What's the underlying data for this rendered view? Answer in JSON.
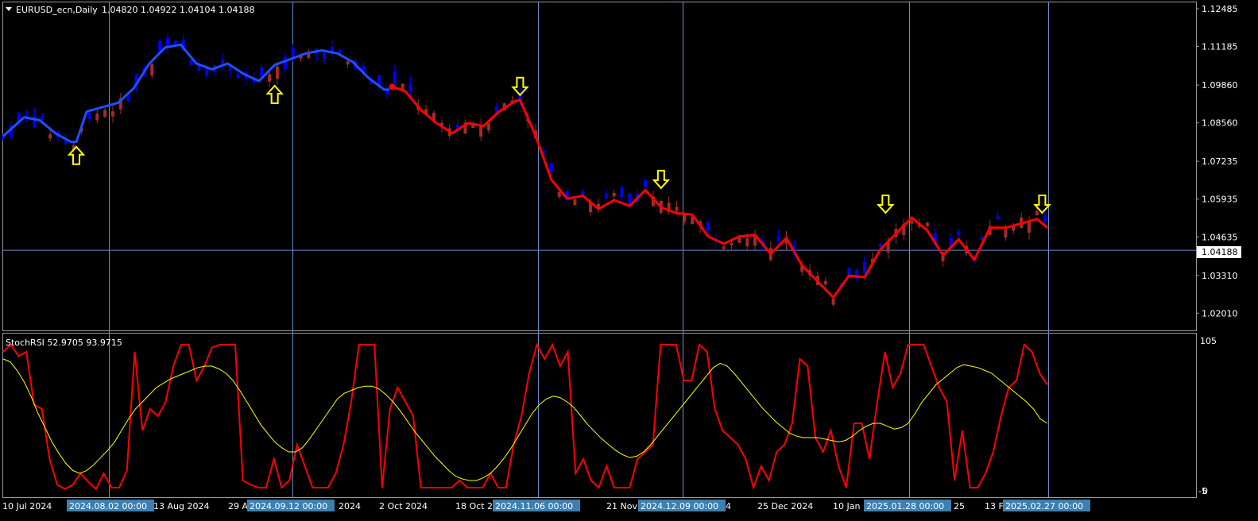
{
  "header": {
    "symbol": "EURUSD_ecn,Daily",
    "ohlc": "1.04820 1.04922 1.04104 1.04188"
  },
  "price_axis": {
    "ticks": [
      "1.12485",
      "1.11185",
      "1.09860",
      "1.08560",
      "1.07235",
      "1.05935",
      "1.04635",
      "1.03310",
      "1.02010"
    ],
    "tick_values": [
      1.12485,
      1.11185,
      1.0986,
      1.0856,
      1.07235,
      1.05935,
      1.04635,
      1.0331,
      1.0201
    ],
    "current_price_label": "1.04188",
    "current_price": 1.04188
  },
  "time_axis": {
    "labels": [
      "10 Jul 2024",
      "13 Aug 2024",
      "29 A",
      "2024",
      "2 Oct 2024",
      "18 Oct 2",
      "21 Nov",
      "4",
      "25 Dec 2024",
      "10 Jan",
      "25",
      "13 F"
    ],
    "highlighted": [
      "2024.08.02 00:00",
      "2024.09.12 00:00",
      "2024.11.06 00:00",
      "2024.12.09 00:00",
      "2025.01.28 00:00",
      "2025.02.27 00:00"
    ]
  },
  "indicator": {
    "label": "StochRSI 52.9705 93.9715",
    "axis_top": "105",
    "axis_bottom": "-5",
    "axis_bottom2": "0"
  },
  "colors": {
    "background": "#000000",
    "bull_candle": "#0000ff",
    "bear_candle": "#a52a2a",
    "trend_up": "#1e50ff",
    "trend_down": "#ff0000",
    "arrows": "#ffff00",
    "stoch_main": "#ff0000",
    "stoch_signal": "#ffff00",
    "crosshair": "#6a8cc8",
    "date_highlight": "#3c7fb1"
  },
  "chart_data": [
    {
      "type": "candlestick",
      "symbol": "EURUSD_ecn",
      "timeframe": "Daily",
      "ylim": [
        1.015,
        1.1265
      ],
      "last_close": 1.04188,
      "trend_line_up": [
        [
          0,
          1.081
        ],
        [
          8,
          1.0875
        ],
        [
          14,
          1.0865
        ],
        [
          20,
          1.082
        ],
        [
          26,
          1.079
        ],
        [
          28,
          1.079
        ],
        [
          32,
          1.0895
        ],
        [
          38,
          1.091
        ],
        [
          44,
          1.0925
        ],
        [
          50,
          1.0975
        ],
        [
          56,
          1.106
        ],
        [
          62,
          1.1115
        ],
        [
          68,
          1.1125
        ],
        [
          74,
          1.106
        ],
        [
          80,
          1.104
        ],
        [
          86,
          1.106
        ],
        [
          92,
          1.1025
        ],
        [
          98,
          1.1
        ],
        [
          104,
          1.1055
        ],
        [
          110,
          1.1075
        ],
        [
          116,
          1.1095
        ],
        [
          122,
          1.1105
        ],
        [
          128,
          1.1095
        ],
        [
          134,
          1.1065
        ],
        [
          140,
          1.101
        ],
        [
          146,
          1.097
        ],
        [
          148,
          1.097
        ]
      ],
      "trend_line_down": [
        [
          149,
          1.098
        ],
        [
          154,
          1.0965
        ],
        [
          160,
          1.09
        ],
        [
          166,
          1.0855
        ],
        [
          172,
          1.082
        ],
        [
          178,
          1.0855
        ],
        [
          184,
          1.0845
        ],
        [
          190,
          1.0895
        ],
        [
          196,
          1.093
        ],
        [
          198,
          1.0935
        ],
        [
          204,
          1.081
        ],
        [
          210,
          1.066
        ],
        [
          216,
          1.0595
        ],
        [
          222,
          1.0605
        ],
        [
          228,
          1.056
        ],
        [
          234,
          1.059
        ],
        [
          240,
          1.057
        ],
        [
          246,
          1.0625
        ],
        [
          252,
          1.0565
        ],
        [
          258,
          1.0545
        ],
        [
          264,
          1.054
        ],
        [
          270,
          1.0465
        ],
        [
          276,
          1.044
        ],
        [
          282,
          1.0465
        ],
        [
          288,
          1.047
        ],
        [
          294,
          1.0405
        ],
        [
          300,
          1.046
        ],
        [
          306,
          1.0365
        ],
        [
          312,
          1.031
        ],
        [
          318,
          1.0255
        ],
        [
          324,
          1.033
        ],
        [
          330,
          1.0325
        ],
        [
          336,
          1.042
        ],
        [
          342,
          1.0475
        ],
        [
          348,
          1.053
        ],
        [
          354,
          1.0485
        ],
        [
          360,
          1.04
        ],
        [
          366,
          1.0455
        ],
        [
          372,
          1.0385
        ],
        [
          378,
          1.0495
        ],
        [
          384,
          1.0495
        ],
        [
          390,
          1.051
        ],
        [
          396,
          1.0525
        ],
        [
          400,
          1.0495
        ]
      ],
      "arrows_up": [
        {
          "i": 28,
          "price": 1.079
        },
        {
          "i": 104,
          "price": 1.1
        }
      ],
      "arrows_down": [
        {
          "i": 198,
          "price": 1.0935
        },
        {
          "i": 252,
          "price": 1.0615
        },
        {
          "i": 338,
          "price": 1.053
        },
        {
          "i": 398,
          "price": 1.053
        }
      ]
    },
    {
      "type": "line",
      "name": "StochRSI",
      "ylim": [
        -5,
        105
      ],
      "last_values": {
        "main": 52.9705,
        "signal": 93.9715
      },
      "series": [
        {
          "values": [
            95,
            100,
            92,
            95,
            58,
            55,
            20,
            2,
            -1,
            2,
            10,
            4,
            -1,
            10,
            0,
            0,
            12,
            95,
            40,
            55,
            50,
            60,
            85,
            100,
            100,
            75,
            85,
            98,
            100,
            100,
            100,
            5,
            2,
            0,
            0,
            20,
            0,
            5,
            30,
            15,
            0,
            0,
            0,
            10,
            30,
            60,
            100,
            100,
            100,
            0,
            55,
            70,
            60,
            50,
            0,
            0,
            0,
            0,
            0,
            5,
            0,
            0,
            0,
            10,
            0,
            0,
            30,
            50,
            80,
            100,
            90,
            100,
            85,
            95,
            10,
            20,
            5,
            0,
            15,
            0,
            0,
            0,
            20,
            25,
            30,
            100,
            100,
            100,
            75,
            75,
            100,
            95,
            55,
            40,
            35,
            30,
            20,
            0,
            15,
            5,
            25,
            30,
            45,
            90,
            85,
            35,
            25,
            40,
            15,
            0,
            45,
            45,
            20,
            60,
            95,
            70,
            80,
            100,
            100,
            100,
            85,
            70,
            60,
            5,
            40,
            0,
            0,
            10,
            25,
            50,
            70,
            75,
            100,
            95,
            80,
            72
          ]
        },
        {
          "values": [
            90,
            88,
            82,
            74,
            64,
            52,
            42,
            32,
            24,
            17,
            12,
            10,
            12,
            16,
            21,
            26,
            32,
            40,
            48,
            55,
            60,
            65,
            70,
            73,
            76,
            78,
            80,
            82,
            84,
            85,
            85,
            83,
            80,
            75,
            68,
            60,
            52,
            44,
            38,
            32,
            28,
            25,
            25,
            28,
            34,
            41,
            48,
            55,
            62,
            66,
            68,
            70,
            71,
            71,
            69,
            65,
            60,
            54,
            47,
            40,
            34,
            28,
            22,
            17,
            12,
            8,
            6,
            5,
            5,
            7,
            10,
            15,
            21,
            28,
            36,
            44,
            52,
            58,
            62,
            64,
            63,
            60,
            56,
            50,
            44,
            39,
            34,
            30,
            26,
            23,
            21,
            22,
            25,
            30,
            36,
            42,
            48,
            54,
            60,
            66,
            72,
            78,
            84,
            87,
            85,
            80,
            74,
            68,
            62,
            56,
            51,
            46,
            42,
            38,
            36,
            35,
            35,
            35,
            34,
            33,
            32,
            33,
            36,
            40,
            43,
            45,
            45,
            43,
            41,
            42,
            45,
            52,
            60,
            66,
            72,
            76,
            80,
            84,
            86,
            85,
            84,
            82,
            80,
            76,
            72,
            68,
            64,
            60,
            55,
            48,
            45
          ]
        }
      ]
    }
  ]
}
